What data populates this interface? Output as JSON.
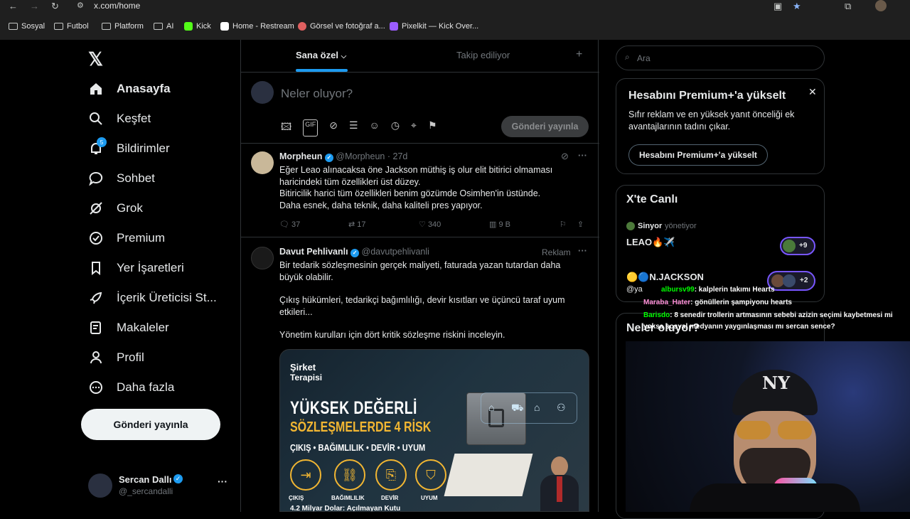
{
  "browser": {
    "url": "x.com/home",
    "bookmarks": [
      "Sosyal",
      "Futbol",
      "Platform",
      "AI",
      "Kick",
      "Home - Restream",
      "Görsel ve fotoğraf a...",
      "Pixelkit — Kick Over..."
    ]
  },
  "sidebar": {
    "items": [
      {
        "label": "Anasayfa"
      },
      {
        "label": "Keşfet"
      },
      {
        "label": "Bildirimler",
        "badge": "5"
      },
      {
        "label": "Sohbet"
      },
      {
        "label": "Grok"
      },
      {
        "label": "Premium"
      },
      {
        "label": "Yer İşaretleri"
      },
      {
        "label": "İçerik Üreticisi St..."
      },
      {
        "label": "Makaleler"
      },
      {
        "label": "Profil"
      },
      {
        "label": "Daha fazla"
      }
    ],
    "post_button": "Gönderi yayınla",
    "account": {
      "name": "Sercan Dallı",
      "handle": "@_sercandalli"
    }
  },
  "feed": {
    "tabs": [
      "Sana özel",
      "Takip ediliyor"
    ],
    "composer": {
      "placeholder": "Neler oluyor?",
      "post_button": "Gönderi yayınla"
    },
    "tweets": [
      {
        "name": "Morpheun",
        "handle": "@Morpheun",
        "time": "· 27d",
        "lines": [
          "Eğer Leao alınacaksa öne Jackson müthiş iş olur elit bitirici olmaması",
          "haricindeki tüm özellikleri üst düzey.",
          "Bitiricilik harici tüm özellikleri benim gözümde Osimhen'in üstünde.",
          "Daha esnek, daha teknik, daha kaliteli pres yapıyor."
        ],
        "replies": "37",
        "reposts": "17",
        "likes": "340",
        "views": "9 B"
      },
      {
        "name": "Davut Pehlivanlı",
        "handle": "@davutpehlivanli",
        "ad_label": "Reklam",
        "paragraphs": [
          "Bir tedarik sözleşmesinin gerçek maliyeti, faturada yazan tutardan daha büyük olabilir.",
          "Çıkış hükümleri, tedarikçi bağımlılığı, devir kısıtları ve üçüncü taraf uyum etkileri...",
          "Yönetim kurulları için dört kritik sözleşme riskini inceleyin."
        ],
        "ad_image": {
          "brand_line1": "Şirket",
          "brand_line2": "Terapisi",
          "headline1": "YÜKSEK DEĞERLİ",
          "headline2": "SÖZLEŞMELERDE 4 RİSK",
          "subline": "ÇIKIŞ • BAĞIMLILIK • DEVİR • UYUM",
          "icons": [
            "ÇIKIŞ",
            "BAĞIMLILIK",
            "DEVİR",
            "UYUM"
          ],
          "footer": "4.2 Milyar Dolar: Açılmayan Kutu"
        }
      }
    ]
  },
  "right": {
    "search_placeholder": "Ara",
    "premium": {
      "title": "Hesabını Premium+'a yükselt",
      "body": "Sıfır reklam ve en yüksek yanıt önceliği ek avantajlarının tadını çıkar.",
      "button": "Hesabını Premium+'a yükselt"
    },
    "live": {
      "title": "X'te Canlı",
      "host": "Sinyor",
      "host_suffix": "yönetiyor",
      "item1": "LEAO🔥✈️",
      "item1_count": "+9",
      "item2": "🟡🔵N.JACKSON",
      "item2_count": "+2",
      "item2_sub": "@ya"
    },
    "happening_title": "Neler oluyor?"
  },
  "chat": [
    {
      "user": "albursv99",
      "msg": ": kalplerin takımı Hearts",
      "color": "#00ff00"
    },
    {
      "user": "Maraba_Hater",
      "msg": ": gönüllerin şampiyonu hearts",
      "color": "#ff8fd8"
    },
    {
      "user": "Barisdo",
      "msg": ": 8 senedir trollerin artmasının sebebi azizin seçimi kaybetmesi mi",
      "color": "#00ff00"
    },
    {
      "user": "",
      "msg": "yoksa sosyal medyanın yaygınlaşması mı sercan sence?",
      "color": "#ffffff"
    }
  ],
  "colors": {
    "accent": "#1d9bf0",
    "verified": "#1d9bf0",
    "bg": "#000000",
    "border": "#2f3336",
    "muted": "#71767b"
  }
}
